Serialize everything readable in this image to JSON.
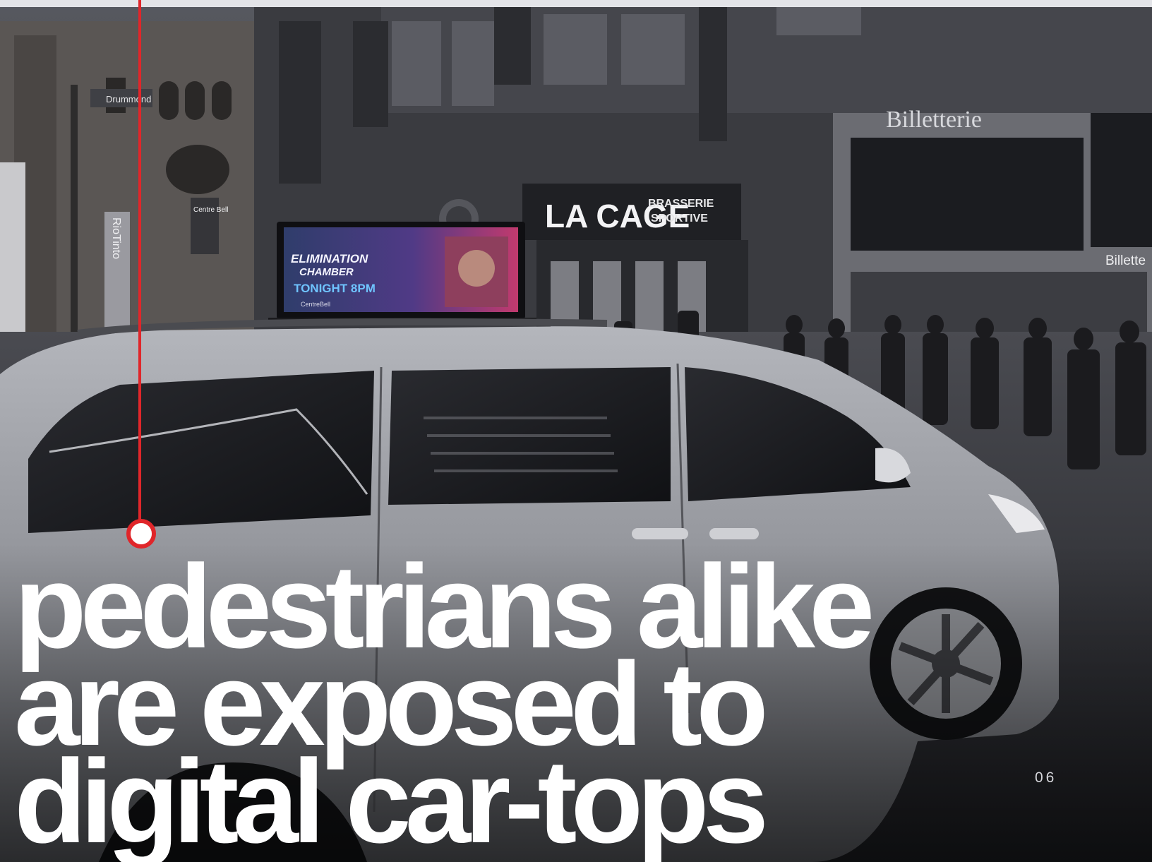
{
  "headline": {
    "lines": [
      "pedestrians alike",
      "are exposed to",
      "digital car-tops"
    ]
  },
  "page_number": "06",
  "photo": {
    "subject": "minivan with digital car-top display in front of an arena",
    "signs": {
      "street_sign": "Drummond",
      "centre_bell_sign": "Centre Bell",
      "rio_tinto_sign": "RioTinto",
      "restaurant_name": "LA CAGE",
      "restaurant_sub1": "BRASSERIE",
      "restaurant_sub2": "SPORTIVE",
      "billetterie_top": "Billetterie",
      "billetterie_side": "Billette",
      "ad_line1": "ELIMINATION",
      "ad_line2": "CHAMBER",
      "ad_line3": "TONIGHT 8PM",
      "ad_footer": "CentreBell"
    }
  },
  "colors": {
    "accent": "#e0262a",
    "headline": "#ffffff",
    "page_number": "#d6d7dc"
  }
}
